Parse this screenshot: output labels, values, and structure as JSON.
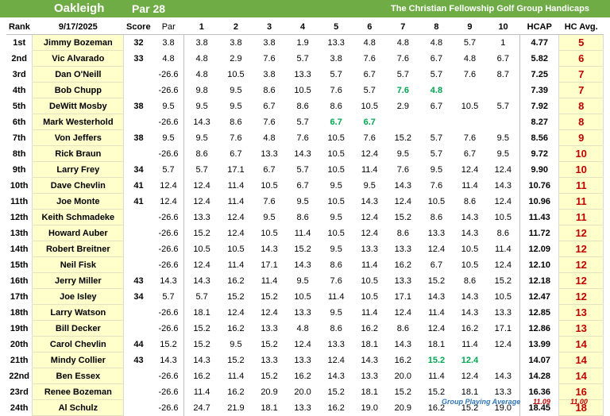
{
  "header": {
    "course": "Oakleigh",
    "par_label": "Par 28",
    "group": "The Christian Fellowship Golf Group Handicaps"
  },
  "columns": {
    "rank": "Rank",
    "date": "9/17/2025",
    "score": "Score",
    "par": "Par",
    "rounds": [
      "1",
      "2",
      "3",
      "4",
      "5",
      "6",
      "7",
      "8",
      "9",
      "10"
    ],
    "hcap": "HCAP",
    "hc_avg": "HC Avg."
  },
  "rows": [
    {
      "rank": "1st",
      "name": "Jimmy Bozeman",
      "score": "32",
      "par": "3.8",
      "rounds": [
        "3.8",
        "3.8",
        "3.8",
        "1.9",
        "13.3",
        "4.8",
        "4.8",
        "4.8",
        "5.7",
        "1"
      ],
      "green": [],
      "hcap": "4.77",
      "avg": "5"
    },
    {
      "rank": "2nd",
      "name": "Vic Alvarado",
      "score": "33",
      "par": "4.8",
      "rounds": [
        "4.8",
        "2.9",
        "7.6",
        "5.7",
        "3.8",
        "7.6",
        "7.6",
        "6.7",
        "4.8",
        "6.7"
      ],
      "green": [],
      "hcap": "5.82",
      "avg": "6"
    },
    {
      "rank": "3rd",
      "name": "Dan O'Neill",
      "score": "",
      "par": "-26.6",
      "rounds": [
        "4.8",
        "10.5",
        "3.8",
        "13.3",
        "5.7",
        "6.7",
        "5.7",
        "5.7",
        "7.6",
        "8.7"
      ],
      "green": [],
      "hcap": "7.25",
      "avg": "7"
    },
    {
      "rank": "4th",
      "name": "Bob Chupp",
      "score": "",
      "par": "-26.6",
      "rounds": [
        "9.8",
        "9.5",
        "8.6",
        "10.5",
        "7.6",
        "5.7",
        "7.6",
        "4.8",
        "",
        ""
      ],
      "green": [
        6,
        7
      ],
      "hcap": "7.39",
      "avg": "7"
    },
    {
      "rank": "5th",
      "name": "DeWitt Mosby",
      "score": "38",
      "par": "9.5",
      "rounds": [
        "9.5",
        "9.5",
        "6.7",
        "8.6",
        "8.6",
        "10.5",
        "2.9",
        "6.7",
        "10.5",
        "5.7"
      ],
      "green": [],
      "hcap": "7.92",
      "avg": "8"
    },
    {
      "rank": "6th",
      "name": "Mark Westerhold",
      "score": "",
      "par": "-26.6",
      "rounds": [
        "14.3",
        "8.6",
        "7.6",
        "5.7",
        "6.7",
        "6.7",
        "",
        "",
        "",
        ""
      ],
      "green": [
        4,
        5
      ],
      "hcap": "8.27",
      "avg": "8"
    },
    {
      "rank": "7th",
      "name": "Von Jeffers",
      "score": "38",
      "par": "9.5",
      "rounds": [
        "9.5",
        "7.6",
        "4.8",
        "7.6",
        "10.5",
        "7.6",
        "15.2",
        "5.7",
        "7.6",
        "9.5"
      ],
      "green": [],
      "hcap": "8.56",
      "avg": "9"
    },
    {
      "rank": "8th",
      "name": "Rick Braun",
      "score": "",
      "par": "-26.6",
      "rounds": [
        "8.6",
        "6.7",
        "13.3",
        "14.3",
        "10.5",
        "12.4",
        "9.5",
        "5.7",
        "6.7",
        "9.5"
      ],
      "green": [],
      "hcap": "9.72",
      "avg": "10"
    },
    {
      "rank": "9th",
      "name": "Larry Frey",
      "score": "34",
      "par": "5.7",
      "rounds": [
        "5.7",
        "17.1",
        "6.7",
        "5.7",
        "10.5",
        "11.4",
        "7.6",
        "9.5",
        "12.4",
        "12.4"
      ],
      "green": [],
      "hcap": "9.90",
      "avg": "10"
    },
    {
      "rank": "10th",
      "name": "Dave Chevlin",
      "score": "41",
      "par": "12.4",
      "rounds": [
        "12.4",
        "11.4",
        "10.5",
        "6.7",
        "9.5",
        "9.5",
        "14.3",
        "7.6",
        "11.4",
        "14.3"
      ],
      "green": [],
      "hcap": "10.76",
      "avg": "11"
    },
    {
      "rank": "11th",
      "name": "Joe Monte",
      "score": "41",
      "par": "12.4",
      "rounds": [
        "12.4",
        "11.4",
        "7.6",
        "9.5",
        "10.5",
        "14.3",
        "12.4",
        "10.5",
        "8.6",
        "12.4"
      ],
      "green": [],
      "hcap": "10.96",
      "avg": "11"
    },
    {
      "rank": "12th",
      "name": "Keith Schmadeke",
      "score": "",
      "par": "-26.6",
      "rounds": [
        "13.3",
        "12.4",
        "9.5",
        "8.6",
        "9.5",
        "12.4",
        "15.2",
        "8.6",
        "14.3",
        "10.5"
      ],
      "green": [],
      "hcap": "11.43",
      "avg": "11"
    },
    {
      "rank": "13th",
      "name": "Howard Auber",
      "score": "",
      "par": "-26.6",
      "rounds": [
        "15.2",
        "12.4",
        "10.5",
        "11.4",
        "10.5",
        "12.4",
        "8.6",
        "13.3",
        "14.3",
        "8.6"
      ],
      "green": [],
      "hcap": "11.72",
      "avg": "12"
    },
    {
      "rank": "14th",
      "name": "Robert Breitner",
      "score": "",
      "par": "-26.6",
      "rounds": [
        "10.5",
        "10.5",
        "14.3",
        "15.2",
        "9.5",
        "13.3",
        "13.3",
        "12.4",
        "10.5",
        "11.4"
      ],
      "green": [],
      "hcap": "12.09",
      "avg": "12"
    },
    {
      "rank": "15th",
      "name": "Neil Fisk",
      "score": "",
      "par": "-26.6",
      "rounds": [
        "12.4",
        "11.4",
        "17.1",
        "14.3",
        "8.6",
        "11.4",
        "16.2",
        "6.7",
        "10.5",
        "12.4"
      ],
      "green": [],
      "hcap": "12.10",
      "avg": "12"
    },
    {
      "rank": "16th",
      "name": "Jerry Miller",
      "score": "43",
      "par": "14.3",
      "rounds": [
        "14.3",
        "16.2",
        "11.4",
        "9.5",
        "7.6",
        "10.5",
        "13.3",
        "15.2",
        "8.6",
        "15.2"
      ],
      "green": [],
      "hcap": "12.18",
      "avg": "12"
    },
    {
      "rank": "17th",
      "name": "Joe Isley",
      "score": "34",
      "par": "5.7",
      "rounds": [
        "5.7",
        "15.2",
        "15.2",
        "10.5",
        "11.4",
        "10.5",
        "17.1",
        "14.3",
        "14.3",
        "10.5"
      ],
      "green": [],
      "hcap": "12.47",
      "avg": "12"
    },
    {
      "rank": "18th",
      "name": "Larry Watson",
      "score": "",
      "par": "-26.6",
      "rounds": [
        "18.1",
        "12.4",
        "12.4",
        "13.3",
        "9.5",
        "11.4",
        "12.4",
        "11.4",
        "14.3",
        "13.3"
      ],
      "green": [],
      "hcap": "12.85",
      "avg": "13"
    },
    {
      "rank": "19th",
      "name": "Bill Decker",
      "score": "",
      "par": "-26.6",
      "rounds": [
        "15.2",
        "16.2",
        "13.3",
        "4.8",
        "8.6",
        "16.2",
        "8.6",
        "12.4",
        "16.2",
        "17.1"
      ],
      "green": [],
      "hcap": "12.86",
      "avg": "13"
    },
    {
      "rank": "20th",
      "name": "Carol Chevlin",
      "score": "44",
      "par": "15.2",
      "rounds": [
        "15.2",
        "9.5",
        "15.2",
        "12.4",
        "13.3",
        "18.1",
        "14.3",
        "18.1",
        "11.4",
        "12.4"
      ],
      "green": [],
      "hcap": "13.99",
      "avg": "14"
    },
    {
      "rank": "21th",
      "name": "Mindy Collier",
      "score": "43",
      "par": "14.3",
      "rounds": [
        "14.3",
        "15.2",
        "13.3",
        "13.3",
        "12.4",
        "14.3",
        "16.2",
        "15.2",
        "12.4",
        ""
      ],
      "green": [
        7,
        8
      ],
      "hcap": "14.07",
      "avg": "14"
    },
    {
      "rank": "22nd",
      "name": "Ben Essex",
      "score": "",
      "par": "-26.6",
      "rounds": [
        "16.2",
        "11.4",
        "15.2",
        "16.2",
        "14.3",
        "13.3",
        "20.0",
        "11.4",
        "12.4",
        "14.3"
      ],
      "green": [],
      "hcap": "14.28",
      "avg": "14"
    },
    {
      "rank": "23rd",
      "name": "Renee Bozeman",
      "score": "",
      "par": "-26.6",
      "rounds": [
        "11.4",
        "16.2",
        "20.9",
        "20.0",
        "15.2",
        "18.1",
        "15.2",
        "15.2",
        "18.1",
        "13.3"
      ],
      "green": [],
      "hcap": "16.36",
      "avg": "16"
    },
    {
      "rank": "24th",
      "name": "Al Schulz",
      "score": "",
      "par": "-26.6",
      "rounds": [
        "24.7",
        "21.9",
        "18.1",
        "13.3",
        "16.2",
        "19.0",
        "20.9",
        "16.2",
        "15.2",
        "19.0"
      ],
      "green": [],
      "hcap": "18.45",
      "avg": "18"
    }
  ],
  "footer": {
    "label": "Group Playing Average",
    "hcap_avg": "11.09",
    "hc_avg": "11.00"
  }
}
